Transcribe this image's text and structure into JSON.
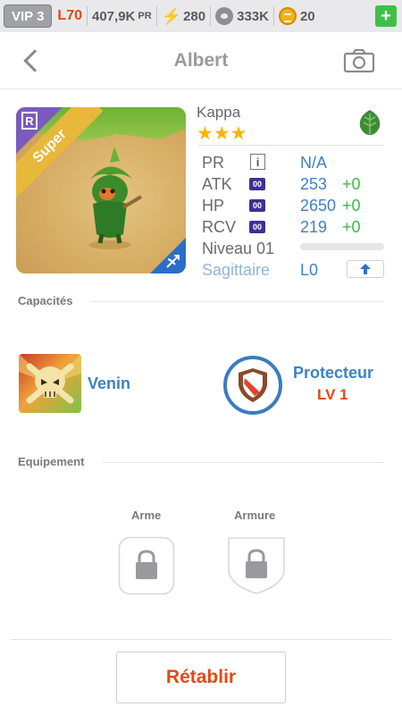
{
  "topbar": {
    "vip": "VIP 3",
    "level": "L70",
    "power_value": "407,9K",
    "power_unit": "PR",
    "energy": "280",
    "food": "333K",
    "gold": "20",
    "add_label": "+"
  },
  "header": {
    "title": "Albert"
  },
  "creature": {
    "rarity_letter": "R",
    "grade": "Super",
    "species": "Kappa",
    "stars": "★★★",
    "element_icon": "leaf-icon",
    "class_icon": "bow-arrow-icon"
  },
  "stats": {
    "pr_label": "PR",
    "pr_info": "i",
    "pr_value": "N/A",
    "atk_label": "ATK",
    "atk_badge": "00",
    "atk_value": "253",
    "atk_bonus": "+0",
    "hp_label": "HP",
    "hp_badge": "00",
    "hp_value": "2650",
    "hp_bonus": "+0",
    "rcv_label": "RCV",
    "rcv_badge": "00",
    "rcv_value": "219",
    "rcv_bonus": "+0",
    "level_label": "Niveau 01",
    "level_progress": 0,
    "class_label": "Sagittaire",
    "class_level": "L0"
  },
  "abilities": {
    "section_title": "Capacités",
    "items": [
      {
        "name": "Venin",
        "icon": "skull-icon"
      },
      {
        "name": "Protecteur",
        "level": "LV 1",
        "icon": "shield-icon"
      }
    ]
  },
  "equipment": {
    "section_title": "Equipement",
    "slots": [
      {
        "label": "Arme",
        "icon": "lock-icon"
      },
      {
        "label": "Armure",
        "icon": "lock-icon"
      }
    ]
  },
  "footer": {
    "reset_label": "Rétablir"
  },
  "colors": {
    "accent_blue": "#3e82c2",
    "accent_orange": "#e24a12",
    "bonus_green": "#3dbb45",
    "star_gold": "#f7b500"
  }
}
